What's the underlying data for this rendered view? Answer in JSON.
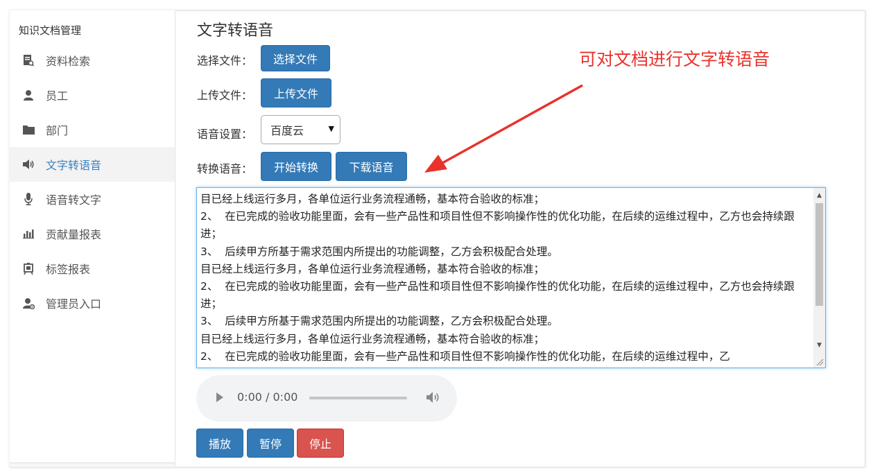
{
  "sidebar": {
    "title": "知识文档管理",
    "items": [
      {
        "label": "资料检索",
        "icon": "book-icon"
      },
      {
        "label": "员工",
        "icon": "user-icon"
      },
      {
        "label": "部门",
        "icon": "folder-icon"
      },
      {
        "label": "文字转语音",
        "icon": "volume-icon",
        "active": true
      },
      {
        "label": "语音转文字",
        "icon": "microphone-icon"
      },
      {
        "label": "贡献量报表",
        "icon": "bar-chart-icon"
      },
      {
        "label": "标签报表",
        "icon": "tag-report-icon"
      },
      {
        "label": "管理员入口",
        "icon": "admin-icon"
      }
    ]
  },
  "main": {
    "title": "文字转语音",
    "choose_file": {
      "label": "选择文件：",
      "button": "选择文件"
    },
    "upload_file": {
      "label": "上传文件：",
      "button": "上传文件"
    },
    "voice_settings": {
      "label": "语音设置：",
      "selected": "百度云"
    },
    "convert": {
      "label": "转换语音：",
      "start_button": "开始转换",
      "download_button": "下载语音"
    },
    "text_content": "目已经上线运行多月，各单位运行业务流程通畅，基本符合验收的标准；\n2、  在已完成的验收功能里面，会有一些产品性和项目性但不影响操作性的优化功能，在后续的运维过程中，乙方也会持续跟进；\n3、  后续甲方所基于需求范围内所提出的功能调整，乙方会积极配合处理。\n目已经上线运行多月，各单位运行业务流程通畅，基本符合验收的标准；\n2、  在已完成的验收功能里面，会有一些产品性和项目性但不影响操作性的优化功能，在后续的运维过程中，乙方也会持续跟进；\n3、  后续甲方所基于需求范围内所提出的功能调整，乙方会积极配合处理。\n目已经上线运行多月，各单位运行业务流程通畅，基本符合验收的标准；\n2、  在已完成的验收功能里面，会有一些产品性和项目性但不影响操作性的优化功能，在后续的运维过程中，乙",
    "audio": {
      "time": "0:00 / 0:00"
    },
    "playback": {
      "play": "播放",
      "pause": "暂停",
      "stop": "停止"
    }
  },
  "annotation": {
    "text": "可对文档进行文字转语音"
  },
  "colors": {
    "primary": "#337ab7",
    "danger": "#d9534f",
    "annotation": "#e8322b",
    "active_nav": "#3a7fc0"
  }
}
